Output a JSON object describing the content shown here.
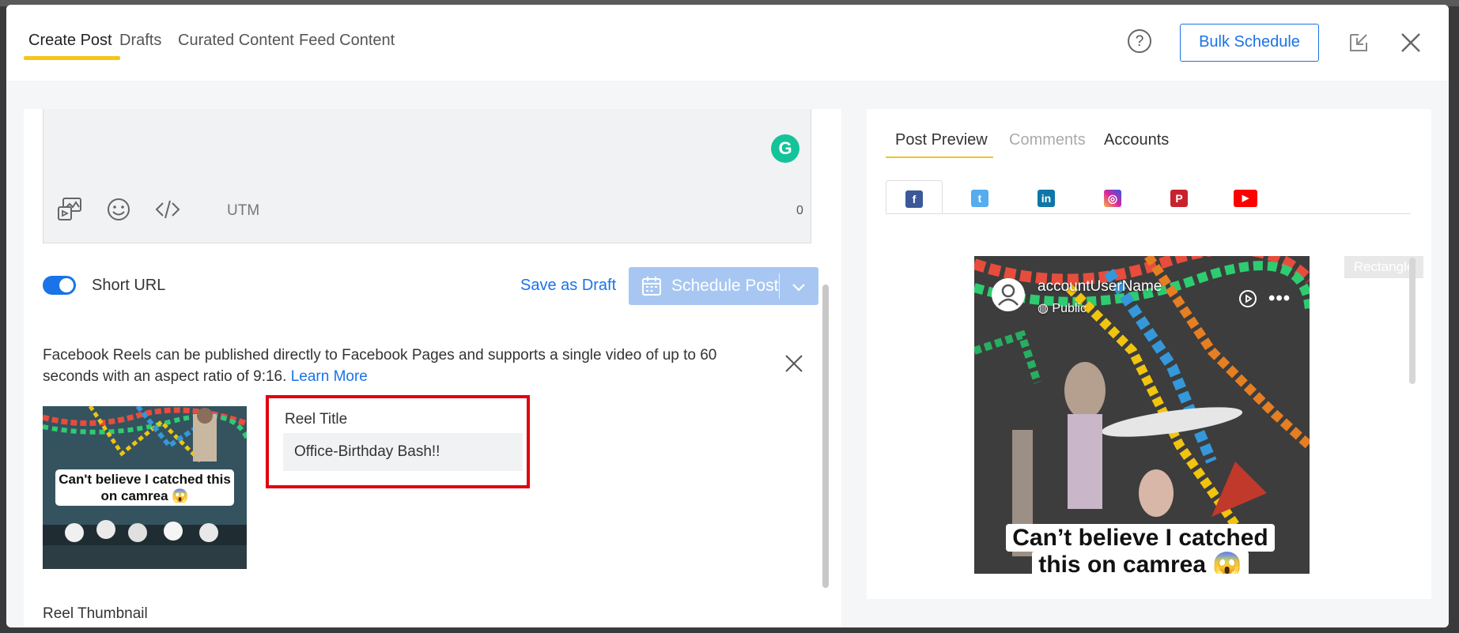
{
  "header": {
    "tabs": [
      {
        "label": "Create Post",
        "active": true
      },
      {
        "label": "Drafts"
      },
      {
        "label": "Curated Content"
      },
      {
        "label": "Feed Content"
      }
    ],
    "help_label": "?",
    "bulk_schedule_label": "Bulk Schedule"
  },
  "composer": {
    "utm_label": "UTM",
    "char_count": "0",
    "grammarly_label": "G"
  },
  "actions": {
    "short_url_label": "Short URL",
    "short_url_enabled": true,
    "save_draft_label": "Save as Draft",
    "schedule_label": "Schedule Post"
  },
  "reel": {
    "notice_text": "Facebook Reels can be published directly to Facebook Pages and supports a single video of up to 60 seconds with an aspect ratio of 9:16.",
    "learn_more_label": "Learn More",
    "thumbnail_caption": "Can't believe I catched this on camrea 😱",
    "title_label": "Reel Title",
    "title_value": "Office-Birthday Bash!!",
    "thumbnail_label": "Reel Thumbnail"
  },
  "preview": {
    "tabs": [
      {
        "label": "Post Preview",
        "active": true
      },
      {
        "label": "Comments",
        "disabled": true
      },
      {
        "label": "Accounts"
      }
    ],
    "platforms": [
      {
        "name": "facebook-icon",
        "color": "#3b5998",
        "glyph": "f"
      },
      {
        "name": "twitter-icon",
        "color": "#55acee",
        "glyph": "t"
      },
      {
        "name": "linkedin-icon",
        "color": "#0e76a8",
        "glyph": "in"
      },
      {
        "name": "instagram-icon",
        "color": "#d6249f",
        "glyph": "◎"
      },
      {
        "name": "pinterest-icon",
        "color": "#c8232c",
        "glyph": "P"
      },
      {
        "name": "youtube-icon",
        "color": "#ff0000",
        "glyph": "▶"
      }
    ],
    "account_name": "accountUserName",
    "visibility": "Public",
    "caption": "Can’t believe I catched this on camrea 😱",
    "rectangle_label": "Rectangle"
  },
  "colors": {
    "accent": "#1a73e8",
    "tab_highlight": "#f5c518",
    "highlight_box": "#e0000f",
    "grammarly": "#15c39a"
  }
}
